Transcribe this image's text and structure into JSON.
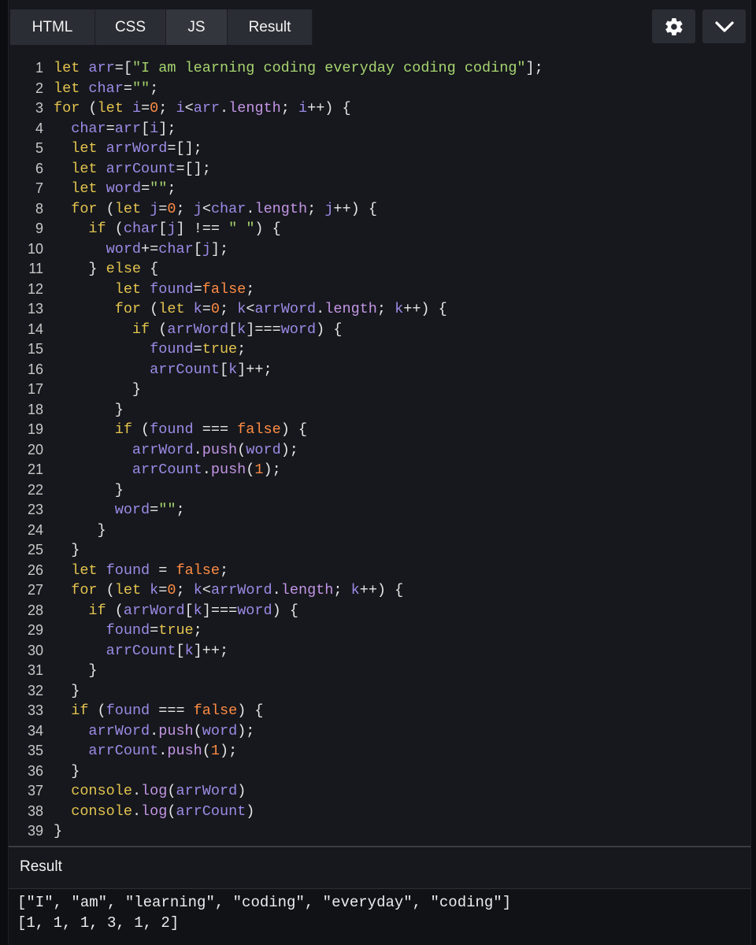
{
  "tabs": [
    {
      "label": "HTML"
    },
    {
      "label": "CSS"
    },
    {
      "label": "JS"
    },
    {
      "label": "Result"
    }
  ],
  "icons": {
    "settings": "gear-icon",
    "collapse": "chevron-down-icon"
  },
  "colors": {
    "background": "#16181d",
    "tab": "#2a2d33",
    "keyword": "#e3c34f",
    "variable": "#9d8ae6",
    "string": "#a8d46f",
    "number": "#ff8c44"
  },
  "line_numbers": [
    "1",
    "2",
    "3",
    "4",
    "5",
    "6",
    "7",
    "8",
    "9",
    "10",
    "11",
    "12",
    "13",
    "14",
    "15",
    "16",
    "17",
    "18",
    "19",
    "20",
    "21",
    "22",
    "23",
    "24",
    "25",
    "26",
    "27",
    "28",
    "29",
    "30",
    "31",
    "32",
    "33",
    "34",
    "35",
    "36",
    "37",
    "38",
    "39"
  ],
  "code_lines": [
    [
      {
        "t": "let ",
        "c": "kw"
      },
      {
        "t": "arr",
        "c": "vr"
      },
      {
        "t": "=[",
        "c": "pl"
      },
      {
        "t": "\"I am learning coding everyday coding coding\"",
        "c": "st"
      },
      {
        "t": "];",
        "c": "pl"
      }
    ],
    [
      {
        "t": "let ",
        "c": "kw"
      },
      {
        "t": "char",
        "c": "vr"
      },
      {
        "t": "=",
        "c": "pl"
      },
      {
        "t": "\"\"",
        "c": "st"
      },
      {
        "t": ";",
        "c": "pl"
      }
    ],
    [
      {
        "t": "for ",
        "c": "kw"
      },
      {
        "t": "(",
        "c": "pl"
      },
      {
        "t": "let ",
        "c": "kw"
      },
      {
        "t": "i",
        "c": "vr"
      },
      {
        "t": "=",
        "c": "pl"
      },
      {
        "t": "0",
        "c": "num"
      },
      {
        "t": "; ",
        "c": "pl"
      },
      {
        "t": "i",
        "c": "vr"
      },
      {
        "t": "<",
        "c": "pl"
      },
      {
        "t": "arr",
        "c": "vr"
      },
      {
        "t": ".",
        "c": "pl"
      },
      {
        "t": "length",
        "c": "pr"
      },
      {
        "t": "; ",
        "c": "pl"
      },
      {
        "t": "i",
        "c": "vr"
      },
      {
        "t": "++) {",
        "c": "pl"
      }
    ],
    [
      {
        "t": "  ",
        "c": "pl"
      },
      {
        "t": "char",
        "c": "vr"
      },
      {
        "t": "=",
        "c": "pl"
      },
      {
        "t": "arr",
        "c": "vr"
      },
      {
        "t": "[",
        "c": "pl"
      },
      {
        "t": "i",
        "c": "vr"
      },
      {
        "t": "];",
        "c": "pl"
      }
    ],
    [
      {
        "t": "  ",
        "c": "pl"
      },
      {
        "t": "let ",
        "c": "kw"
      },
      {
        "t": "arrWord",
        "c": "vr"
      },
      {
        "t": "=[];",
        "c": "pl"
      }
    ],
    [
      {
        "t": "  ",
        "c": "pl"
      },
      {
        "t": "let ",
        "c": "kw"
      },
      {
        "t": "arrCount",
        "c": "vr"
      },
      {
        "t": "=[];",
        "c": "pl"
      }
    ],
    [
      {
        "t": "  ",
        "c": "pl"
      },
      {
        "t": "let ",
        "c": "kw"
      },
      {
        "t": "word",
        "c": "vr"
      },
      {
        "t": "=",
        "c": "pl"
      },
      {
        "t": "\"\"",
        "c": "st"
      },
      {
        "t": ";",
        "c": "pl"
      }
    ],
    [
      {
        "t": "  ",
        "c": "pl"
      },
      {
        "t": "for ",
        "c": "kw"
      },
      {
        "t": "(",
        "c": "pl"
      },
      {
        "t": "let ",
        "c": "kw"
      },
      {
        "t": "j",
        "c": "vr"
      },
      {
        "t": "=",
        "c": "pl"
      },
      {
        "t": "0",
        "c": "num"
      },
      {
        "t": "; ",
        "c": "pl"
      },
      {
        "t": "j",
        "c": "vr"
      },
      {
        "t": "<",
        "c": "pl"
      },
      {
        "t": "char",
        "c": "vr"
      },
      {
        "t": ".",
        "c": "pl"
      },
      {
        "t": "length",
        "c": "pr"
      },
      {
        "t": "; ",
        "c": "pl"
      },
      {
        "t": "j",
        "c": "vr"
      },
      {
        "t": "++) {",
        "c": "pl"
      }
    ],
    [
      {
        "t": "    ",
        "c": "pl"
      },
      {
        "t": "if ",
        "c": "kw"
      },
      {
        "t": "(",
        "c": "pl"
      },
      {
        "t": "char",
        "c": "vr"
      },
      {
        "t": "[",
        "c": "pl"
      },
      {
        "t": "j",
        "c": "vr"
      },
      {
        "t": "] !== ",
        "c": "pl"
      },
      {
        "t": "\" \"",
        "c": "st"
      },
      {
        "t": ") {",
        "c": "pl"
      }
    ],
    [
      {
        "t": "      ",
        "c": "pl"
      },
      {
        "t": "word",
        "c": "vr"
      },
      {
        "t": "+=",
        "c": "pl"
      },
      {
        "t": "char",
        "c": "vr"
      },
      {
        "t": "[",
        "c": "pl"
      },
      {
        "t": "j",
        "c": "vr"
      },
      {
        "t": "];",
        "c": "pl"
      }
    ],
    [
      {
        "t": "    } ",
        "c": "pl"
      },
      {
        "t": "else",
        "c": "kw"
      },
      {
        "t": " {",
        "c": "pl"
      }
    ],
    [
      {
        "t": "       ",
        "c": "pl"
      },
      {
        "t": "let ",
        "c": "kw"
      },
      {
        "t": "found",
        "c": "vr"
      },
      {
        "t": "=",
        "c": "pl"
      },
      {
        "t": "false",
        "c": "bo"
      },
      {
        "t": ";",
        "c": "pl"
      }
    ],
    [
      {
        "t": "       ",
        "c": "pl"
      },
      {
        "t": "for ",
        "c": "kw"
      },
      {
        "t": "(",
        "c": "pl"
      },
      {
        "t": "let ",
        "c": "kw"
      },
      {
        "t": "k",
        "c": "vr"
      },
      {
        "t": "=",
        "c": "pl"
      },
      {
        "t": "0",
        "c": "num"
      },
      {
        "t": "; ",
        "c": "pl"
      },
      {
        "t": "k",
        "c": "vr"
      },
      {
        "t": "<",
        "c": "pl"
      },
      {
        "t": "arrWord",
        "c": "vr"
      },
      {
        "t": ".",
        "c": "pl"
      },
      {
        "t": "length",
        "c": "pr"
      },
      {
        "t": "; ",
        "c": "pl"
      },
      {
        "t": "k",
        "c": "vr"
      },
      {
        "t": "++) {",
        "c": "pl"
      }
    ],
    [
      {
        "t": "         ",
        "c": "pl"
      },
      {
        "t": "if ",
        "c": "kw"
      },
      {
        "t": "(",
        "c": "pl"
      },
      {
        "t": "arrWord",
        "c": "vr"
      },
      {
        "t": "[",
        "c": "pl"
      },
      {
        "t": "k",
        "c": "vr"
      },
      {
        "t": "]===",
        "c": "pl"
      },
      {
        "t": "word",
        "c": "vr"
      },
      {
        "t": ") {",
        "c": "pl"
      }
    ],
    [
      {
        "t": "           ",
        "c": "pl"
      },
      {
        "t": "found",
        "c": "vr"
      },
      {
        "t": "=",
        "c": "pl"
      },
      {
        "t": "true",
        "c": "kw"
      },
      {
        "t": ";",
        "c": "pl"
      }
    ],
    [
      {
        "t": "           ",
        "c": "pl"
      },
      {
        "t": "arrCount",
        "c": "vr"
      },
      {
        "t": "[",
        "c": "pl"
      },
      {
        "t": "k",
        "c": "vr"
      },
      {
        "t": "]++;",
        "c": "pl"
      }
    ],
    [
      {
        "t": "         }",
        "c": "pl"
      }
    ],
    [
      {
        "t": "       }",
        "c": "pl"
      }
    ],
    [
      {
        "t": "       ",
        "c": "pl"
      },
      {
        "t": "if ",
        "c": "kw"
      },
      {
        "t": "(",
        "c": "pl"
      },
      {
        "t": "found",
        "c": "vr"
      },
      {
        "t": " === ",
        "c": "pl"
      },
      {
        "t": "false",
        "c": "bo"
      },
      {
        "t": ") {",
        "c": "pl"
      }
    ],
    [
      {
        "t": "         ",
        "c": "pl"
      },
      {
        "t": "arrWord",
        "c": "vr"
      },
      {
        "t": ".",
        "c": "pl"
      },
      {
        "t": "push",
        "c": "pr"
      },
      {
        "t": "(",
        "c": "pl"
      },
      {
        "t": "word",
        "c": "vr"
      },
      {
        "t": ");",
        "c": "pl"
      }
    ],
    [
      {
        "t": "         ",
        "c": "pl"
      },
      {
        "t": "arrCount",
        "c": "vr"
      },
      {
        "t": ".",
        "c": "pl"
      },
      {
        "t": "push",
        "c": "pr"
      },
      {
        "t": "(",
        "c": "pl"
      },
      {
        "t": "1",
        "c": "num"
      },
      {
        "t": ");",
        "c": "pl"
      }
    ],
    [
      {
        "t": "       }",
        "c": "pl"
      }
    ],
    [
      {
        "t": "       ",
        "c": "pl"
      },
      {
        "t": "word",
        "c": "vr"
      },
      {
        "t": "=",
        "c": "pl"
      },
      {
        "t": "\"\"",
        "c": "st"
      },
      {
        "t": ";",
        "c": "pl"
      }
    ],
    [
      {
        "t": "     }",
        "c": "pl"
      }
    ],
    [
      {
        "t": "  }",
        "c": "pl"
      }
    ],
    [
      {
        "t": "  ",
        "c": "pl"
      },
      {
        "t": "let ",
        "c": "kw"
      },
      {
        "t": "found",
        "c": "vr"
      },
      {
        "t": " = ",
        "c": "pl"
      },
      {
        "t": "false",
        "c": "bo"
      },
      {
        "t": ";",
        "c": "pl"
      }
    ],
    [
      {
        "t": "  ",
        "c": "pl"
      },
      {
        "t": "for ",
        "c": "kw"
      },
      {
        "t": "(",
        "c": "pl"
      },
      {
        "t": "let ",
        "c": "kw"
      },
      {
        "t": "k",
        "c": "vr"
      },
      {
        "t": "=",
        "c": "pl"
      },
      {
        "t": "0",
        "c": "num"
      },
      {
        "t": "; ",
        "c": "pl"
      },
      {
        "t": "k",
        "c": "vr"
      },
      {
        "t": "<",
        "c": "pl"
      },
      {
        "t": "arrWord",
        "c": "vr"
      },
      {
        "t": ".",
        "c": "pl"
      },
      {
        "t": "length",
        "c": "pr"
      },
      {
        "t": "; ",
        "c": "pl"
      },
      {
        "t": "k",
        "c": "vr"
      },
      {
        "t": "++) {",
        "c": "pl"
      }
    ],
    [
      {
        "t": "    ",
        "c": "pl"
      },
      {
        "t": "if ",
        "c": "kw"
      },
      {
        "t": "(",
        "c": "pl"
      },
      {
        "t": "arrWord",
        "c": "vr"
      },
      {
        "t": "[",
        "c": "pl"
      },
      {
        "t": "k",
        "c": "vr"
      },
      {
        "t": "]===",
        "c": "pl"
      },
      {
        "t": "word",
        "c": "vr"
      },
      {
        "t": ") {",
        "c": "pl"
      }
    ],
    [
      {
        "t": "      ",
        "c": "pl"
      },
      {
        "t": "found",
        "c": "vr"
      },
      {
        "t": "=",
        "c": "pl"
      },
      {
        "t": "true",
        "c": "kw"
      },
      {
        "t": ";",
        "c": "pl"
      }
    ],
    [
      {
        "t": "      ",
        "c": "pl"
      },
      {
        "t": "arrCount",
        "c": "vr"
      },
      {
        "t": "[",
        "c": "pl"
      },
      {
        "t": "k",
        "c": "vr"
      },
      {
        "t": "]++;",
        "c": "pl"
      }
    ],
    [
      {
        "t": "    }",
        "c": "pl"
      }
    ],
    [
      {
        "t": "  }",
        "c": "pl"
      }
    ],
    [
      {
        "t": "  ",
        "c": "pl"
      },
      {
        "t": "if ",
        "c": "kw"
      },
      {
        "t": "(",
        "c": "pl"
      },
      {
        "t": "found",
        "c": "vr"
      },
      {
        "t": " === ",
        "c": "pl"
      },
      {
        "t": "false",
        "c": "bo"
      },
      {
        "t": ") {",
        "c": "pl"
      }
    ],
    [
      {
        "t": "    ",
        "c": "pl"
      },
      {
        "t": "arrWord",
        "c": "vr"
      },
      {
        "t": ".",
        "c": "pl"
      },
      {
        "t": "push",
        "c": "pr"
      },
      {
        "t": "(",
        "c": "pl"
      },
      {
        "t": "word",
        "c": "vr"
      },
      {
        "t": ");",
        "c": "pl"
      }
    ],
    [
      {
        "t": "    ",
        "c": "pl"
      },
      {
        "t": "arrCount",
        "c": "vr"
      },
      {
        "t": ".",
        "c": "pl"
      },
      {
        "t": "push",
        "c": "pr"
      },
      {
        "t": "(",
        "c": "pl"
      },
      {
        "t": "1",
        "c": "num"
      },
      {
        "t": ");",
        "c": "pl"
      }
    ],
    [
      {
        "t": "  }",
        "c": "pl"
      }
    ],
    [
      {
        "t": "  ",
        "c": "pl"
      },
      {
        "t": "console",
        "c": "kw"
      },
      {
        "t": ".",
        "c": "pl"
      },
      {
        "t": "log",
        "c": "pr"
      },
      {
        "t": "(",
        "c": "pl"
      },
      {
        "t": "arrWord",
        "c": "vr"
      },
      {
        "t": ")",
        "c": "pl"
      }
    ],
    [
      {
        "t": "  ",
        "c": "pl"
      },
      {
        "t": "console",
        "c": "kw"
      },
      {
        "t": ".",
        "c": "pl"
      },
      {
        "t": "log",
        "c": "pr"
      },
      {
        "t": "(",
        "c": "pl"
      },
      {
        "t": "arrCount",
        "c": "vr"
      },
      {
        "t": ")",
        "c": "pl"
      }
    ],
    [
      {
        "t": "}",
        "c": "pl"
      }
    ]
  ],
  "result": {
    "label": "Result",
    "lines": [
      "[\"I\", \"am\", \"learning\", \"coding\", \"everyday\", \"coding\"]",
      "[1, 1, 1, 3, 1, 2]"
    ]
  }
}
